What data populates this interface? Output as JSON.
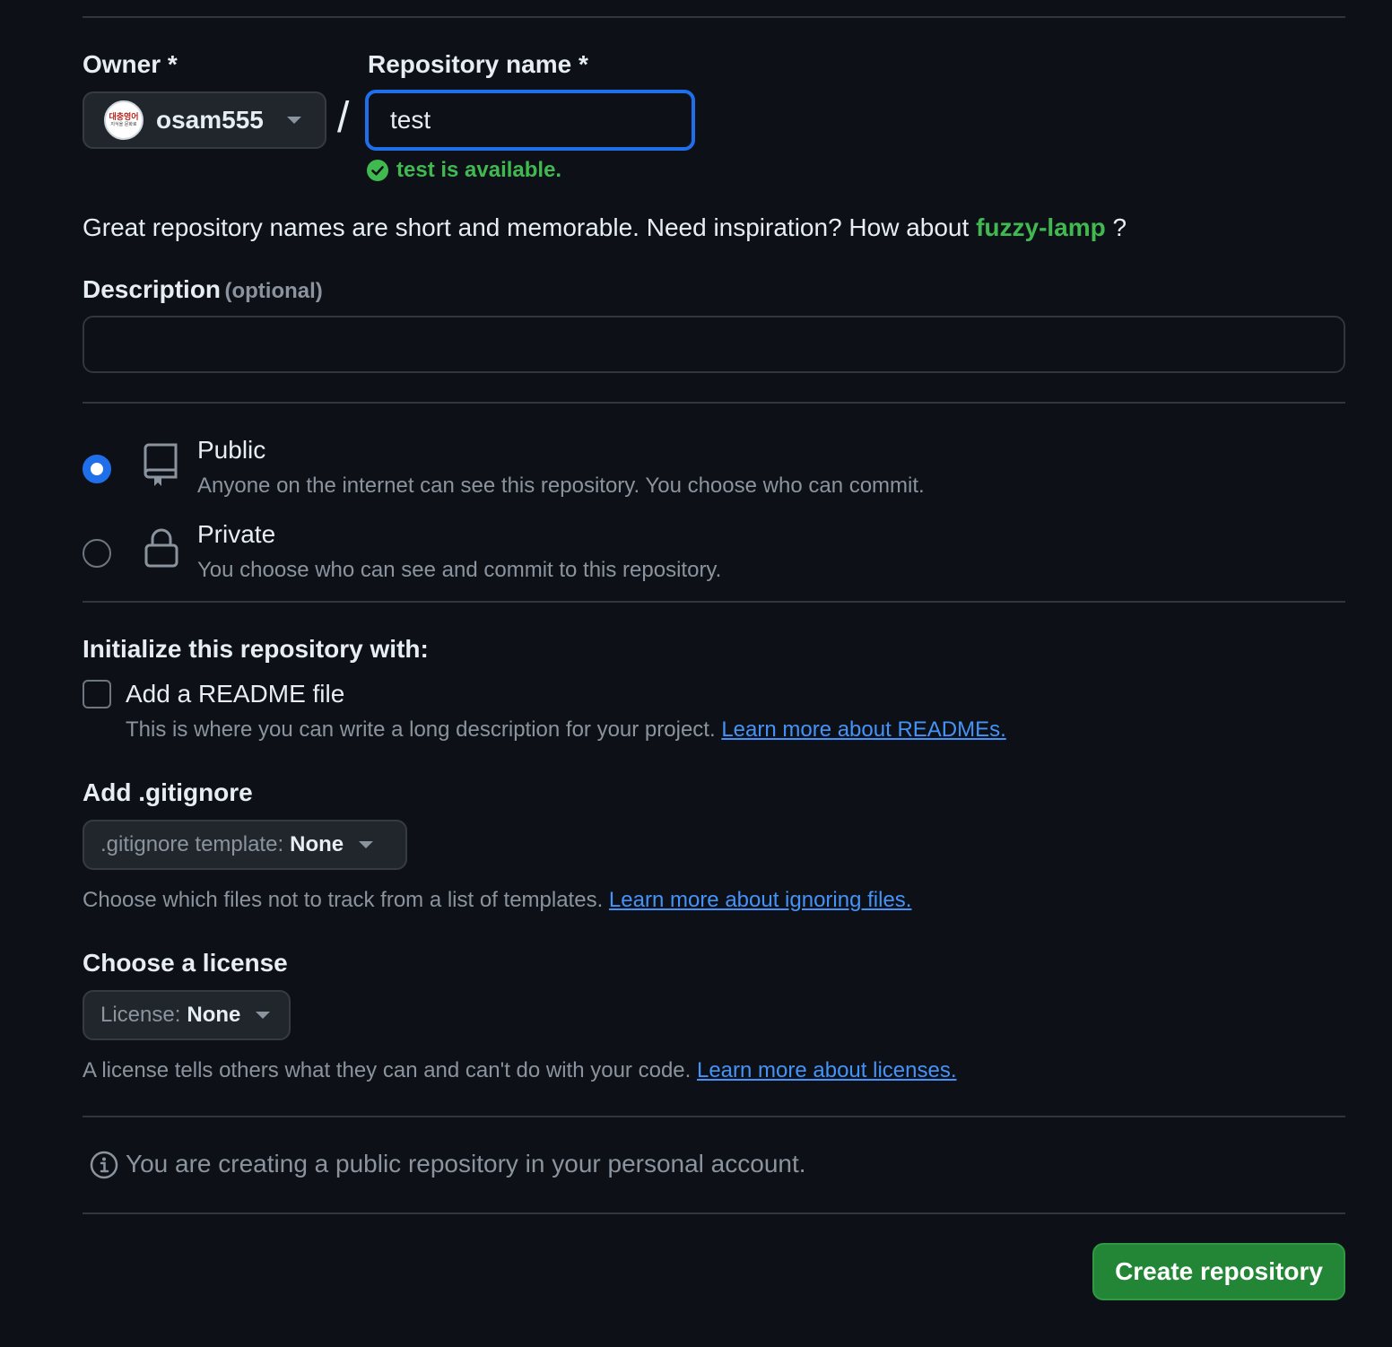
{
  "owner": {
    "label": "Owner *",
    "name": "osam555",
    "avatar_text": "대충영어",
    "avatar_subtext": "지식을 문화로"
  },
  "separator": "/",
  "repo_name": {
    "label": "Repository name *",
    "value": "test",
    "availability": "test is available."
  },
  "suggestion": {
    "text": "Great repository names are short and memorable. Need inspiration? How about",
    "name": "fuzzy-lamp",
    "end": "?"
  },
  "description": {
    "label": "Description",
    "optional": "(optional)",
    "value": "",
    "placeholder": ""
  },
  "visibility": {
    "public": {
      "title": "Public",
      "desc": "Anyone on the internet can see this repository. You choose who can commit.",
      "icon": "repo-icon",
      "selected": true
    },
    "private": {
      "title": "Private",
      "desc": "You choose who can see and commit to this repository.",
      "icon": "lock-icon",
      "selected": false
    }
  },
  "initialize": {
    "heading": "Initialize this repository with:",
    "readme": {
      "label": "Add a README file",
      "desc": "This is where you can write a long description for your project.",
      "link": "Learn more about READMEs.",
      "checked": false
    }
  },
  "gitignore": {
    "heading": "Add .gitignore",
    "select_prefix": ".gitignore template:",
    "select_value": "None",
    "desc": "Choose which files not to track from a list of templates.",
    "link": "Learn more about ignoring files."
  },
  "license": {
    "heading": "Choose a license",
    "select_prefix": "License:",
    "select_value": "None",
    "desc": "A license tells others what they can and can't do with your code.",
    "link": "Learn more about licenses."
  },
  "notice": {
    "text": "You are creating a public repository in your personal account.",
    "icon": "info-icon"
  },
  "submit": {
    "label": "Create repository"
  },
  "colors": {
    "background": "#0d1117",
    "accent_blue": "#1f6feb",
    "success_green": "#3fb950",
    "button_green": "#238636",
    "link_blue": "#4493f8",
    "muted_text": "#8b949e"
  }
}
